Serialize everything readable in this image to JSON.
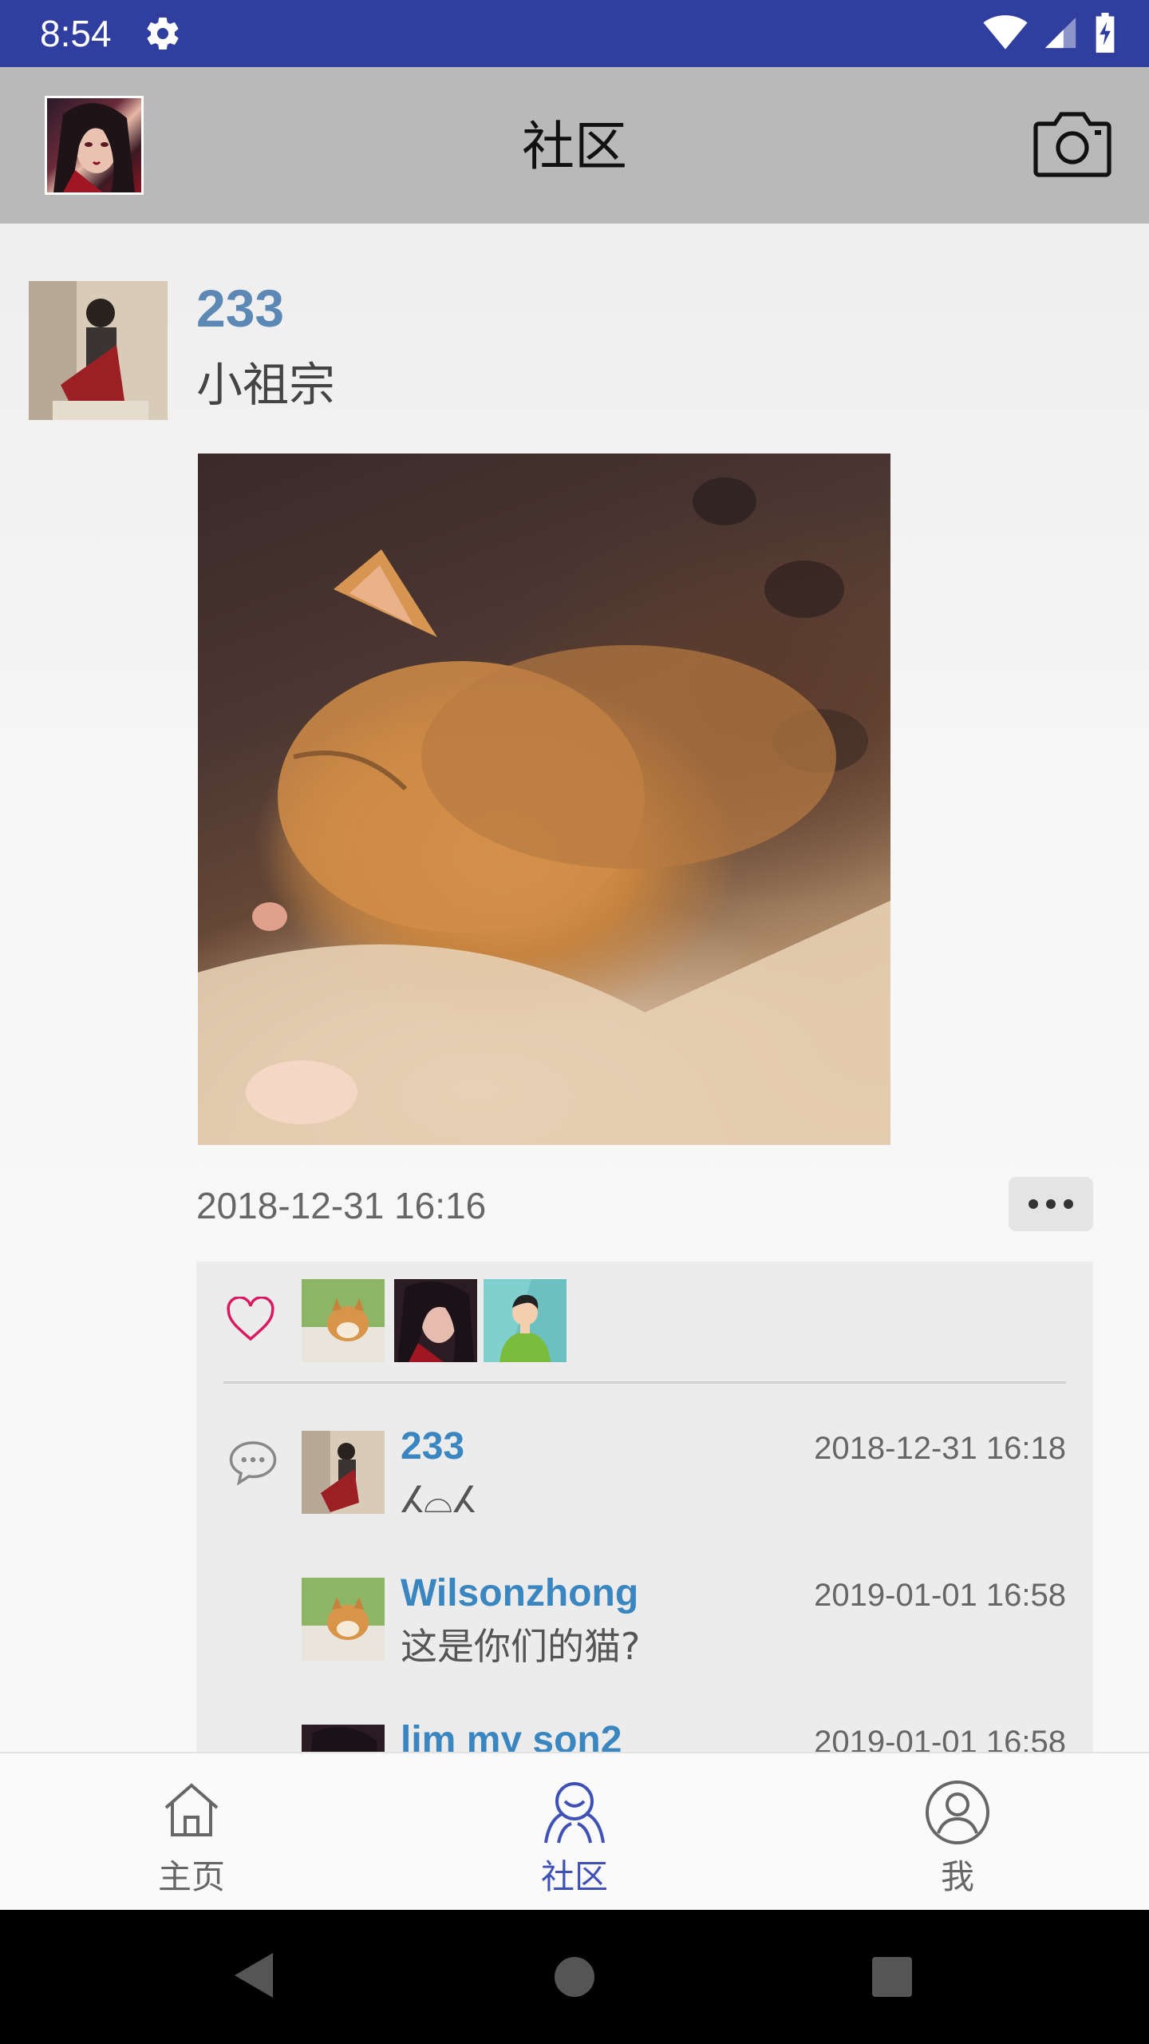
{
  "status_bar": {
    "time": "8:54",
    "icons": [
      "settings-icon",
      "wifi-icon",
      "signal-icon",
      "battery-charging-icon"
    ]
  },
  "app_bar": {
    "title": "社区",
    "avatar": "profile-avatar",
    "action_icon": "camera-icon"
  },
  "post": {
    "username": "233",
    "text": "小祖宗",
    "timestamp": "2018-12-31 16:16",
    "photo": "sleeping-kitten-photo",
    "more_icon": "more-horizontal-icon",
    "likes": {
      "icon": "heart-outline-icon",
      "avatars": [
        "shiba-dog-avatar",
        "warrior-girl-avatar",
        "man-avatar"
      ]
    },
    "comments_icon": "chat-bubble-icon",
    "comments": [
      {
        "name": "233",
        "time": "2018-12-31 16:18",
        "text": "ⵃ⌓ⵃ",
        "avatar": "girl-avatar"
      },
      {
        "name": "Wilsonzhong",
        "time": "2019-01-01 16:58",
        "text": "这是你们的猫?",
        "avatar": "shiba-dog-avatar"
      },
      {
        "name": "lim my son2",
        "time": "2019-01-01 16:58",
        "text": "",
        "avatar": "warrior-girl-avatar"
      }
    ]
  },
  "bottom_nav": {
    "items": [
      {
        "label": "主页",
        "icon": "home-icon",
        "active": false
      },
      {
        "label": "社区",
        "icon": "community-icon",
        "active": true
      },
      {
        "label": "我",
        "icon": "person-icon",
        "active": false
      }
    ],
    "active_color": "#3f51b5"
  },
  "system_nav": {
    "icons": [
      "back-icon",
      "home-circle-icon",
      "recents-icon"
    ]
  },
  "colors": {
    "status_bar": "#303f9f",
    "app_bar": "#b9b9b9",
    "username": "#5b88b5",
    "comment_name": "#3a86c0",
    "heart": "#d81b60"
  }
}
